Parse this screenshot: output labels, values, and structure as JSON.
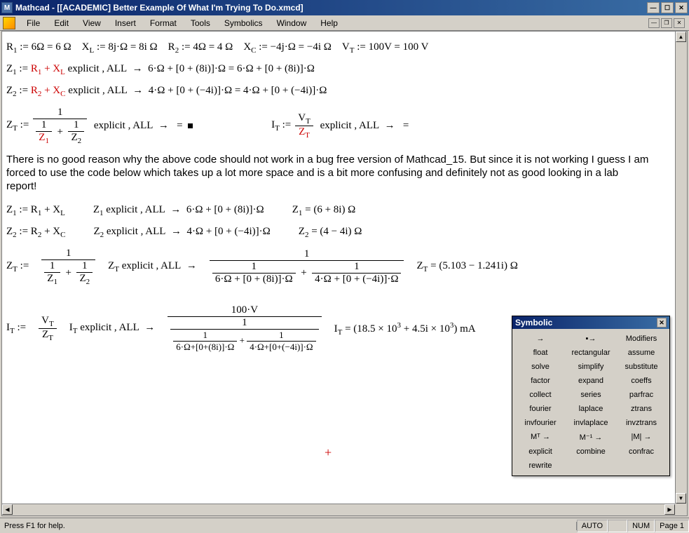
{
  "window": {
    "title": "Mathcad - [[ACADEMIC] Better Example Of What I'm Trying To Do.xmcd]",
    "app_letter": "M"
  },
  "menu": {
    "items": [
      "File",
      "Edit",
      "View",
      "Insert",
      "Format",
      "Tools",
      "Symbolics",
      "Window",
      "Help"
    ]
  },
  "worksheet": {
    "line1": {
      "R1": "R₁ := 6Ω = 6 Ω",
      "XL": "X_L := 8j·Ω = 8i Ω",
      "R2": "R₂ := 4Ω = 4 Ω",
      "XC": "X_C := −4j·Ω = −4i Ω",
      "VT": "V_T := 100V = 100 V"
    },
    "line2": "Z₁ := R₁ + X_L  explicit , ALL  →  6·Ω + [0 + (8i)]·Ω = 6·Ω + [0 + (8i)]·Ω",
    "line3": "Z₂ := R₂ + X_C  explicit , ALL  →  4·Ω + [0 + (−4i)]·Ω = 4·Ω + [0 + (−4i)]·Ω",
    "line4_left": "Z_T :=",
    "line4_right": "explicit , ALL  →   =",
    "line4_IT_left": "I_T :=",
    "line4_IT_right": "explicit , ALL  →   =",
    "paragraph": "There is no good reason why the above code should not work in a bug free version of Mathcad_15.  But since it is not working I guess I am forced to use the code below which takes up a lot more space and is a bit more confusing and definitely not as good looking in a lab report!",
    "z1_def": "Z₁ := R₁ + X_L",
    "z1_exp": "Z₁ explicit , ALL  →  6·Ω + [0 + (8i)]·Ω",
    "z1_val": "Z₁ = (6 + 8i) Ω",
    "z2_def": "Z₂ := R₂ + X_C",
    "z2_exp": "Z₂ explicit , ALL  →  4·Ω + [0 + (−4i)]·Ω",
    "z2_val": "Z₂ = (4 − 4i) Ω",
    "zt_def_left": "Z_T :=",
    "zt_exp_left": "Z_T explicit , ALL  →",
    "zt_val": "Z_T = (5.103 − 1.241i) Ω",
    "it_def_left": "I_T :=",
    "it_exp_left": "I_T explicit , ALL  →",
    "it_val": "I_T = (18.5 × 10³ + 4.5i × 10³) mA",
    "frac_pieces": {
      "one": "1",
      "Z1": "Z₁",
      "Z2": "Z₂",
      "VT": "V_T",
      "ZT": "Z_T",
      "d1": "6·Ω + [0 + (8i)]·Ω",
      "d2": "4·Ω + [0 + (−4i)]·Ω",
      "d1s": "6·Ω+[0+(8i)]·Ω",
      "d2s": "4·Ω+[0+(−4i)]·Ω",
      "hundredV": "100·V"
    }
  },
  "symbolic_toolbar": {
    "title": "Symbolic",
    "cells": [
      "→",
      "▪→",
      "Modifiers",
      "float",
      "rectangular",
      "assume",
      "solve",
      "simplify",
      "substitute",
      "factor",
      "expand",
      "coeffs",
      "collect",
      "series",
      "parfrac",
      "fourier",
      "laplace",
      "ztrans",
      "invfourier",
      "invlaplace",
      "invztrans",
      "Mᵀ →",
      "M⁻¹ →",
      "|M| →",
      "explicit",
      "combine",
      "confrac",
      "rewrite",
      "",
      ""
    ]
  },
  "statusbar": {
    "help": "Press F1 for help.",
    "auto": "AUTO",
    "num": "NUM",
    "page": "Page 1"
  }
}
